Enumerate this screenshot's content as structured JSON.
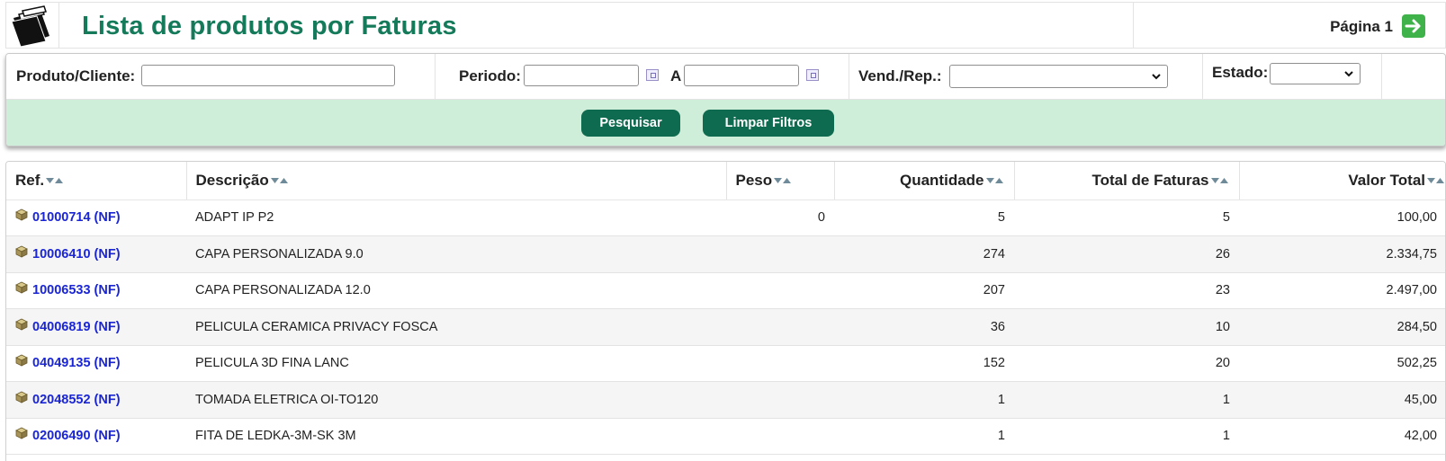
{
  "header": {
    "title": "Lista de produtos por Faturas",
    "page_label": "Página 1",
    "logo_icon": "folder-documents-icon",
    "next_icon": "arrow-right-icon"
  },
  "filters": {
    "produto_label": "Produto/Cliente:",
    "produto_value": "",
    "periodo_label": "Periodo:",
    "periodo_from": "",
    "periodo_sep": "A",
    "periodo_to": "",
    "vend_label": "Vend./Rep.:",
    "vend_value": "",
    "estado_label": "Estado:",
    "estado_value": "",
    "search_button": "Pesquisar",
    "clear_button": "Limpar Filtros"
  },
  "table": {
    "columns": [
      "Ref.",
      "Descrição",
      "Peso",
      "Quantidade",
      "Total de Faturas",
      "Valor Total"
    ],
    "rows": [
      {
        "ref": "01000714 (NF)",
        "descricao": "ADAPT IP P2",
        "peso": "0",
        "quantidade": "5",
        "total_faturas": "5",
        "valor_total": "100,00"
      },
      {
        "ref": "10006410 (NF)",
        "descricao": "CAPA PERSONALIZADA 9.0",
        "peso": "",
        "quantidade": "274",
        "total_faturas": "26",
        "valor_total": "2.334,75"
      },
      {
        "ref": "10006533 (NF)",
        "descricao": "CAPA PERSONALIZADA 12.0",
        "peso": "",
        "quantidade": "207",
        "total_faturas": "23",
        "valor_total": "2.497,00"
      },
      {
        "ref": "04006819 (NF)",
        "descricao": "PELICULA CERAMICA PRIVACY FOSCA",
        "peso": "",
        "quantidade": "36",
        "total_faturas": "10",
        "valor_total": "284,50"
      },
      {
        "ref": "04049135 (NF)",
        "descricao": "PELICULA 3D FINA LANC",
        "peso": "",
        "quantidade": "152",
        "total_faturas": "20",
        "valor_total": "502,25"
      },
      {
        "ref": "02048552 (NF)",
        "descricao": "TOMADA ELETRICA OI-TO120",
        "peso": "",
        "quantidade": "1",
        "total_faturas": "1",
        "valor_total": "45,00"
      },
      {
        "ref": "02006490 (NF)",
        "descricao": "FITA DE LEDKA-3M-SK 3M",
        "peso": "",
        "quantidade": "1",
        "total_faturas": "1",
        "valor_total": "42,00"
      }
    ]
  },
  "colors": {
    "title": "#147a5a",
    "button": "#0f6b4f",
    "action_bar": "#cfeeda",
    "link": "#1a25d6",
    "next_button": "#3fb34a"
  }
}
